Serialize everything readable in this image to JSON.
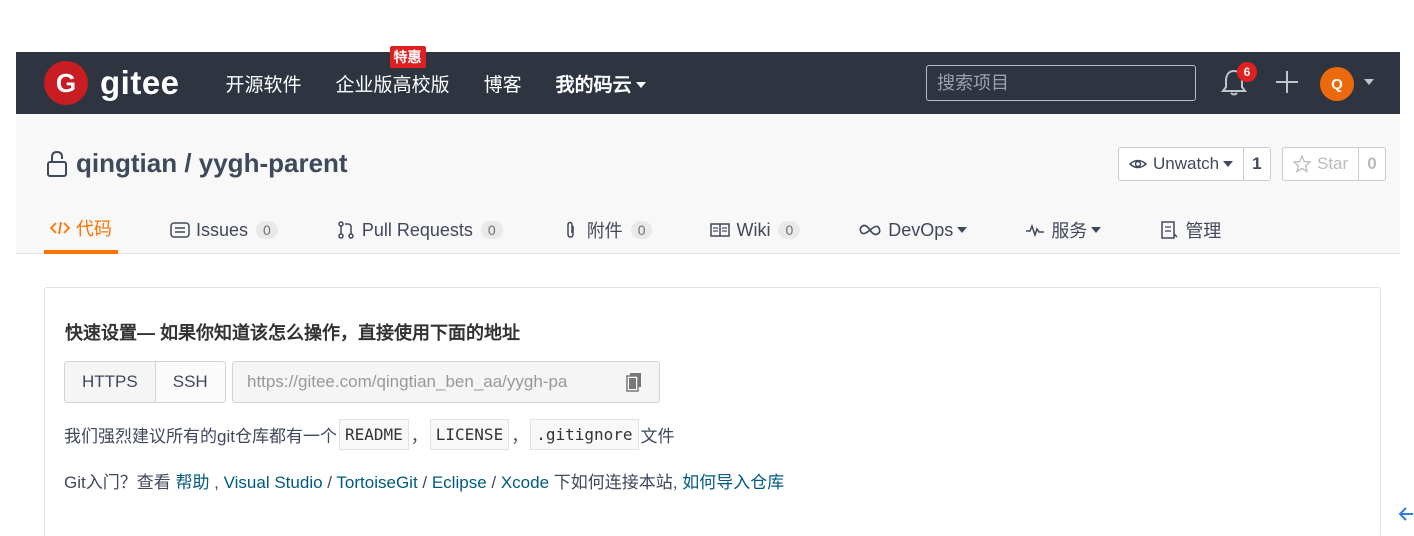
{
  "navbar": {
    "logo_mark": "G",
    "logo_text": "gitee",
    "links": [
      {
        "label": "开源软件"
      },
      {
        "label": "企业版",
        "badge": "特惠"
      },
      {
        "label": "高校版"
      },
      {
        "label": "博客"
      },
      {
        "label": "我的码云"
      }
    ],
    "search_placeholder": "搜索项目",
    "notification_count": "6",
    "avatar_letter": "Q",
    "background": "#2e3540"
  },
  "repo": {
    "title": "qingtian / yygh-parent",
    "watch": {
      "label": "Unwatch",
      "count": "1"
    },
    "star": {
      "label": "Star",
      "count": "0"
    },
    "tabs": [
      {
        "label": "代码",
        "icon": "code-icon"
      },
      {
        "label": "Issues",
        "count": "0",
        "icon": "issues-icon"
      },
      {
        "label": "Pull Requests",
        "count": "0",
        "icon": "pull-request-icon"
      },
      {
        "label": "附件",
        "count": "0",
        "icon": "paperclip-icon"
      },
      {
        "label": "Wiki",
        "count": "0",
        "icon": "book-icon"
      },
      {
        "label": "DevOps",
        "icon": "infinity-icon"
      },
      {
        "label": "服务",
        "icon": "pulse-icon"
      },
      {
        "label": "管理",
        "icon": "manage-icon"
      }
    ],
    "accent_color": "#fe7300"
  },
  "setup": {
    "title": "快速设置— 如果你知道该怎么操作，直接使用下面的地址",
    "protocols": [
      "HTTPS",
      "SSH"
    ],
    "url": "https://gitee.com/qingtian_ben_aa/yygh-pa",
    "recommend": {
      "prefix": "我们强烈建议所有的git仓库都有一个",
      "files": [
        "README",
        "LICENSE",
        ".gitignore"
      ],
      "sep": "，",
      "suffix": "文件"
    },
    "help": {
      "prefix": "Git入门？查看 ",
      "links": [
        "帮助",
        "Visual Studio",
        "TortoiseGit",
        "Eclipse",
        "Xcode"
      ],
      "mid": " 下如何连接本站, ",
      "import_link": "如何导入仓库"
    },
    "link_color": "#005980"
  }
}
